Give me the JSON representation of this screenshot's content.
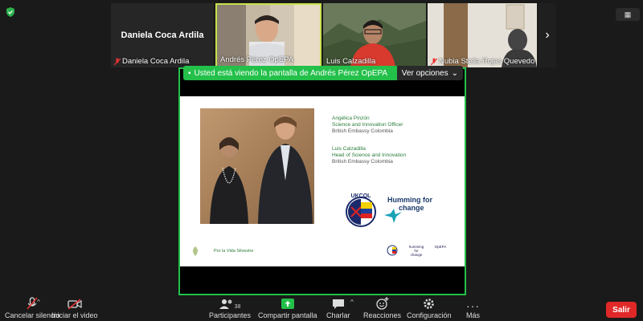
{
  "view_button": {
    "label": ""
  },
  "participants_strip": [
    {
      "name": "Daniela Coca Ardila",
      "big_name": "Daniela Coca Ardila",
      "muted": true
    },
    {
      "name": "Andrés Pérez OpEPA",
      "muted": false,
      "active": true
    },
    {
      "name": "Luis Calzadilla",
      "muted": false
    },
    {
      "name": "Nubia Stella Rojas Quevedo",
      "muted": true
    }
  ],
  "share_banner": {
    "message": "Usted está viendo la pantalla de Andrés Pérez OpEPA",
    "options_label": "Ver opciones"
  },
  "slide": {
    "speaker1": {
      "name": "Angélica Pinzón",
      "role": "Science and Innovation Officer",
      "org": "British Embassy Colombia"
    },
    "speaker2": {
      "name": "Luis Calzadilla",
      "role": "Head of Science and Innovation",
      "org": "British Embassy Colombia"
    },
    "hum_line1": "Humming for",
    "hum_line2": "change",
    "ukcol_label": "UKCOL",
    "footer_text": "Por la Vida Silvestre",
    "footer_logos": [
      "UKCOL",
      "humming for change",
      "OpEPA"
    ]
  },
  "toolbar": {
    "mute": "Cancelar silencio",
    "video": "Iniciar el video",
    "participants": "Participantes",
    "participants_count": "38",
    "share": "Compartir pantalla",
    "chat": "Charlar",
    "reactions": "Reacciones",
    "settings": "Configuración",
    "more": "Más",
    "leave": "Salir"
  },
  "colors": {
    "share_green": "#23c04a",
    "leave_red": "#e02828",
    "active_tile": "#c7e24b"
  }
}
